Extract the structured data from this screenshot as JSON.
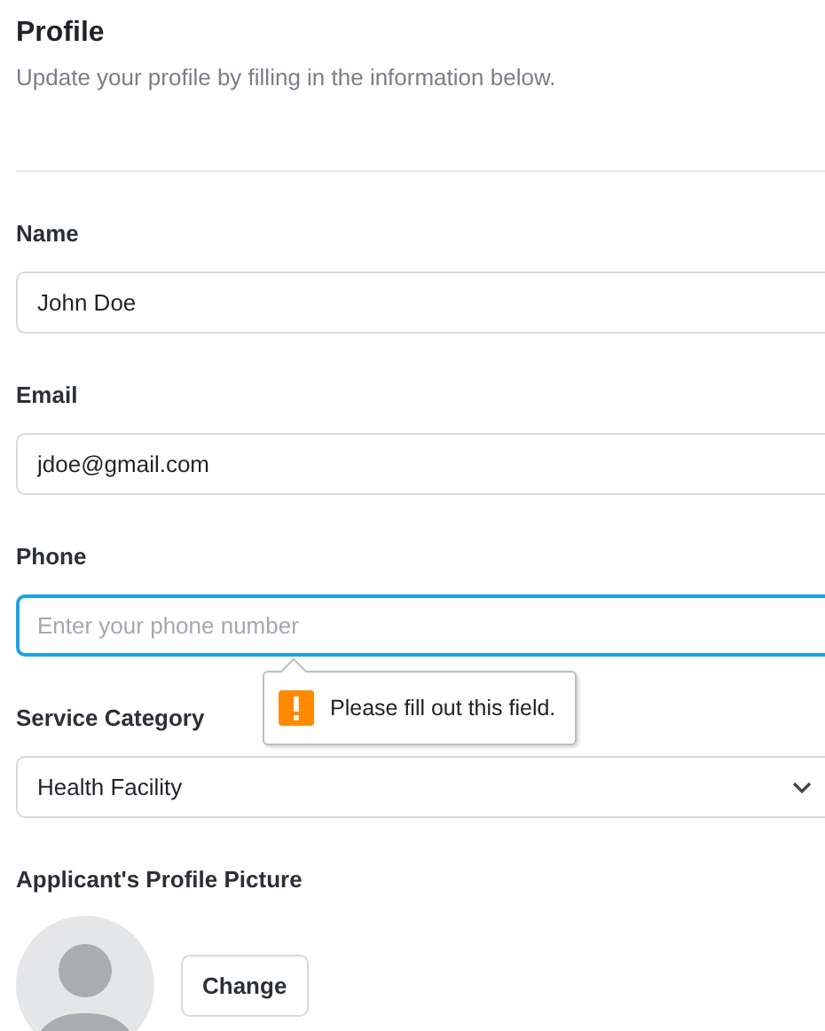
{
  "header": {
    "title": "Profile",
    "subtitle": "Update your profile by filling in the information below."
  },
  "fields": [
    {
      "kind": "text",
      "label": "Name",
      "value": "John Doe",
      "focused": false
    },
    {
      "kind": "text",
      "label": "Email",
      "value": "jdoe@gmail.com",
      "focused": false
    },
    {
      "kind": "text",
      "label": "Phone",
      "placeholder": "Enter your phone number",
      "focused": true,
      "tooltip": "Please fill out this field."
    },
    {
      "kind": "select",
      "label": "Service Category",
      "value": "Health Facility",
      "focused": false
    }
  ],
  "picture_section": {
    "label": "Applicant's Profile Picture",
    "button": "Change"
  }
}
